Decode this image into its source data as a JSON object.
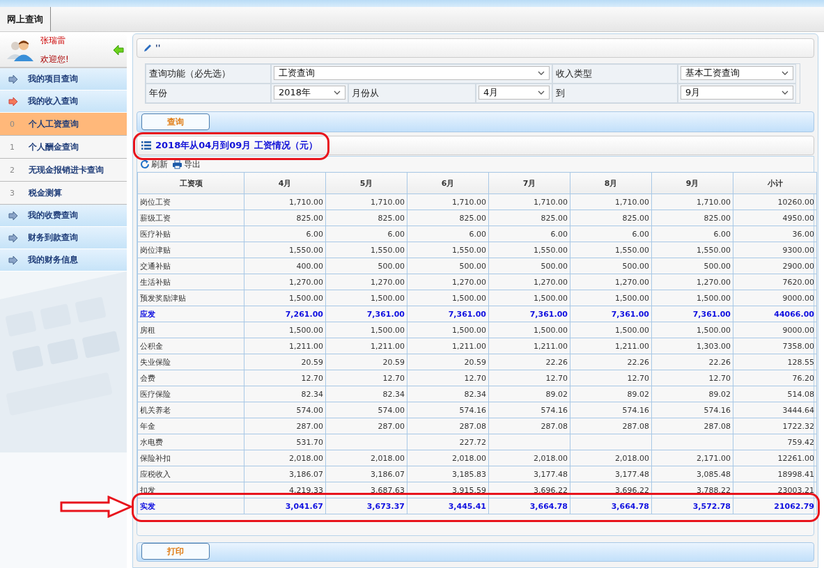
{
  "top_tabs": [
    {
      "label": "网上查询",
      "selected": true
    }
  ],
  "user": {
    "name": "张瑞雷",
    "greeting": "欢迎您!"
  },
  "sidebar": {
    "items": [
      {
        "label": "我的项目查询",
        "expanded": false,
        "selected": false
      },
      {
        "label": "我的收入查询",
        "expanded": true,
        "selected": false,
        "children": [
          {
            "index": "0",
            "label": "个人工资查询",
            "selected": true
          },
          {
            "index": "1",
            "label": "个人酬金查询",
            "selected": false
          },
          {
            "index": "2",
            "label": "无现金报销进卡查询",
            "selected": false
          },
          {
            "index": "3",
            "label": "税金测算",
            "selected": false
          }
        ]
      },
      {
        "label": "我的收费查询",
        "expanded": false,
        "selected": false
      },
      {
        "label": "财务到款查询",
        "expanded": false,
        "selected": false
      },
      {
        "label": "我的财务信息",
        "expanded": false,
        "selected": false
      }
    ]
  },
  "form_panel": {
    "title": "''"
  },
  "form": {
    "fields": [
      {
        "label": "查询功能（必先选）",
        "value": "工资查询",
        "kind": "wide"
      },
      {
        "label": "收入类型",
        "value": "基本工资查询",
        "kind": "normal"
      },
      {
        "label": "年份",
        "value": "2018年",
        "kind": "normal"
      },
      {
        "label": "月份从",
        "value": "4月",
        "kind": "normal"
      },
      {
        "label": "到",
        "value": "9月",
        "kind": "normal"
      }
    ]
  },
  "query_button": "查询",
  "result": {
    "title": "2018年从04月到09月 工资情况（元）",
    "toolbar": [
      {
        "label": "刷新",
        "kind": "refresh"
      },
      {
        "label": "导出",
        "kind": "print"
      }
    ],
    "table": {
      "columns": [
        "工资项",
        "4月",
        "5月",
        "6月",
        "7月",
        "8月",
        "9月",
        "小计"
      ],
      "rows": [
        {
          "kind": "normal",
          "cells": [
            "岗位工资",
            "1,710.00",
            "1,710.00",
            "1,710.00",
            "1,710.00",
            "1,710.00",
            "1,710.00",
            "10260.00"
          ]
        },
        {
          "kind": "normal",
          "cells": [
            "薪级工资",
            "825.00",
            "825.00",
            "825.00",
            "825.00",
            "825.00",
            "825.00",
            "4950.00"
          ]
        },
        {
          "kind": "normal",
          "cells": [
            "医疗补贴",
            "6.00",
            "6.00",
            "6.00",
            "6.00",
            "6.00",
            "6.00",
            "36.00"
          ]
        },
        {
          "kind": "normal",
          "cells": [
            "岗位津贴",
            "1,550.00",
            "1,550.00",
            "1,550.00",
            "1,550.00",
            "1,550.00",
            "1,550.00",
            "9300.00"
          ]
        },
        {
          "kind": "normal",
          "cells": [
            "交通补贴",
            "400.00",
            "500.00",
            "500.00",
            "500.00",
            "500.00",
            "500.00",
            "2900.00"
          ]
        },
        {
          "kind": "normal",
          "cells": [
            "生活补贴",
            "1,270.00",
            "1,270.00",
            "1,270.00",
            "1,270.00",
            "1,270.00",
            "1,270.00",
            "7620.00"
          ]
        },
        {
          "kind": "normal",
          "cells": [
            "预发奖励津贴",
            "1,500.00",
            "1,500.00",
            "1,500.00",
            "1,500.00",
            "1,500.00",
            "1,500.00",
            "9000.00"
          ]
        },
        {
          "kind": "total",
          "cells": [
            "应发",
            "7,261.00",
            "7,361.00",
            "7,361.00",
            "7,361.00",
            "7,361.00",
            "7,361.00",
            "44066.00"
          ]
        },
        {
          "kind": "normal",
          "cells": [
            "房租",
            "1,500.00",
            "1,500.00",
            "1,500.00",
            "1,500.00",
            "1,500.00",
            "1,500.00",
            "9000.00"
          ]
        },
        {
          "kind": "normal",
          "cells": [
            "公积金",
            "1,211.00",
            "1,211.00",
            "1,211.00",
            "1,211.00",
            "1,211.00",
            "1,303.00",
            "7358.00"
          ]
        },
        {
          "kind": "normal",
          "cells": [
            "失业保险",
            "20.59",
            "20.59",
            "20.59",
            "22.26",
            "22.26",
            "22.26",
            "128.55"
          ]
        },
        {
          "kind": "normal",
          "cells": [
            "会费",
            "12.70",
            "12.70",
            "12.70",
            "12.70",
            "12.70",
            "12.70",
            "76.20"
          ]
        },
        {
          "kind": "normal",
          "cells": [
            "医疗保险",
            "82.34",
            "82.34",
            "82.34",
            "89.02",
            "89.02",
            "89.02",
            "514.08"
          ]
        },
        {
          "kind": "normal",
          "cells": [
            "机关养老",
            "574.00",
            "574.00",
            "574.16",
            "574.16",
            "574.16",
            "574.16",
            "3444.64"
          ]
        },
        {
          "kind": "normal",
          "cells": [
            "年金",
            "287.00",
            "287.00",
            "287.08",
            "287.08",
            "287.08",
            "287.08",
            "1722.32"
          ]
        },
        {
          "kind": "normal",
          "cells": [
            "水电费",
            "531.70",
            null,
            "227.72",
            null,
            null,
            null,
            "759.42"
          ]
        },
        {
          "kind": "normal",
          "cells": [
            "保险补扣",
            "2,018.00",
            "2,018.00",
            "2,018.00",
            "2,018.00",
            "2,018.00",
            "2,171.00",
            "12261.00"
          ]
        },
        {
          "kind": "normal",
          "cells": [
            "应税收入",
            "3,186.07",
            "3,186.07",
            "3,185.83",
            "3,177.48",
            "3,177.48",
            "3,085.48",
            "18998.41"
          ]
        },
        {
          "kind": "normal",
          "cells": [
            "扣发",
            "4,219.33",
            "3,687.63",
            "3,915.59",
            "3,696.22",
            "3,696.22",
            "3,788.22",
            "23003.21"
          ]
        },
        {
          "kind": "total",
          "cells": [
            "实发",
            "3,041.67",
            "3,673.37",
            "3,445.41",
            "3,664.78",
            "3,664.78",
            "3,572.78",
            "21062.79"
          ]
        }
      ]
    }
  },
  "print_button": "打印"
}
